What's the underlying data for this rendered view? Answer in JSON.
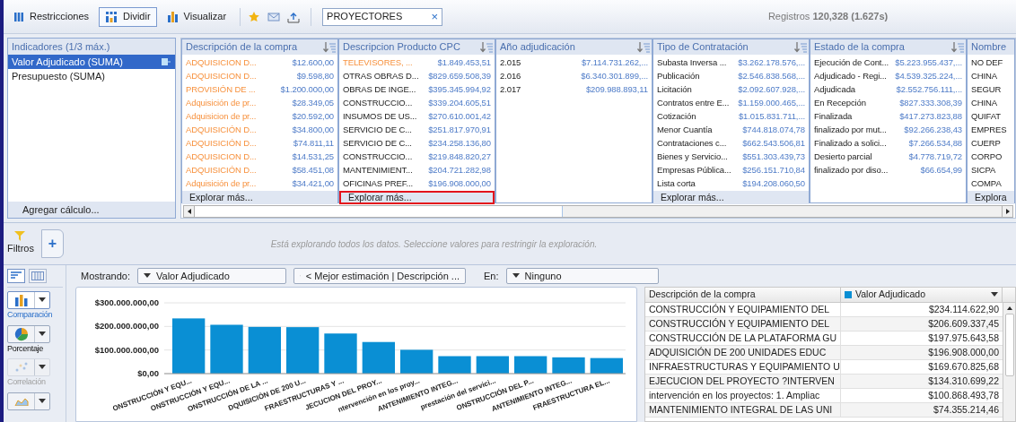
{
  "toolbar": {
    "buttons": [
      {
        "kind": "restrict",
        "label": "Restricciones",
        "selected": false
      },
      {
        "kind": "split",
        "label": "Dividir",
        "selected": true
      },
      {
        "kind": "visualize",
        "label": "Visualizar",
        "selected": false
      }
    ],
    "search": {
      "value": "PROYECTORES",
      "clear": "×"
    },
    "status": "Registros **120,328 (1.627s)**"
  },
  "indicators": {
    "title": "Indicadores (1/3 máx.)",
    "items": [
      {
        "label": "Valor Adjudicado (SUMA)",
        "selected": true
      },
      {
        "label": "Presupuesto (SUMA)",
        "selected": false
      }
    ],
    "footer": "Agregar cálculo..."
  },
  "columns": [
    {
      "header": "Descripción de la compra",
      "rows": [
        {
          "label": "ADQUISICION D...",
          "value": "$12.600,00",
          "highlighted": true
        },
        {
          "label": "ADQUISICION D...",
          "value": "$9.598,80",
          "highlighted": true
        },
        {
          "label": "PROVISIÓN DE ...",
          "value": "$1.200.000,00",
          "highlighted": true
        },
        {
          "label": "Adquisición de pr...",
          "value": "$28.349,05",
          "highlighted": true
        },
        {
          "label": "Adquisicion de pr...",
          "value": "$20.592,00",
          "highlighted": true
        },
        {
          "label": "ADQUISICIÓN D...",
          "value": "$34.800,00",
          "highlighted": true
        },
        {
          "label": "ADQUISICIÓN D...",
          "value": "$74.811,11",
          "highlighted": true
        },
        {
          "label": "ADQUISICION D...",
          "value": "$14.531,25",
          "highlighted": true
        },
        {
          "label": "ADQUISICIÓN D...",
          "value": "$58.451,08",
          "highlighted": true
        },
        {
          "label": "Adquisición de pr...",
          "value": "$34.421,00",
          "highlighted": true
        }
      ],
      "explore": {
        "label": "Explorar más...",
        "outlined": false
      }
    },
    {
      "header": "Descripcion Producto CPC",
      "rows": [
        {
          "label": "TELEVISORES, ...",
          "value": "$1.849.453,51",
          "highlighted": true
        },
        {
          "label": "OTRAS OBRAS D...",
          "value": "$829.659.508,39",
          "highlighted": false
        },
        {
          "label": "OBRAS DE INGE...",
          "value": "$395.345.994,92",
          "highlighted": false
        },
        {
          "label": "CONSTRUCCIO...",
          "value": "$339.204.605,51",
          "highlighted": false
        },
        {
          "label": "INSUMOS DE US...",
          "value": "$270.610.001,42",
          "highlighted": false
        },
        {
          "label": "SERVICIO DE C...",
          "value": "$251.817.970,91",
          "highlighted": false
        },
        {
          "label": "SERVICIO DE C...",
          "value": "$234.258.136,80",
          "highlighted": false
        },
        {
          "label": "CONSTRUCCIO...",
          "value": "$219.848.820,27",
          "highlighted": false
        },
        {
          "label": "MANTENIMIENT...",
          "value": "$204.721.282,98",
          "highlighted": false
        },
        {
          "label": "OFICINAS PREF...",
          "value": "$196.908.000,00",
          "highlighted": false
        }
      ],
      "explore": {
        "label": "Explorar más...",
        "outlined": true
      }
    },
    {
      "header": "Año adjudicación",
      "rows": [
        {
          "label": "2.015",
          "value": "$7.114.731.262,...",
          "highlighted": false
        },
        {
          "label": "2.016",
          "value": "$6.340.301.899,...",
          "highlighted": false
        },
        {
          "label": "2.017",
          "value": "$209.988.893,11",
          "highlighted": false
        }
      ]
    },
    {
      "header": "Tipo de Contratación",
      "rows": [
        {
          "label": "Subasta Inversa ...",
          "value": "$3.262.178.576,...",
          "highlighted": false
        },
        {
          "label": "Publicación",
          "value": "$2.546.838.568,...",
          "highlighted": false
        },
        {
          "label": "Licitación",
          "value": "$2.092.607.928,...",
          "highlighted": false
        },
        {
          "label": "Contratos entre E...",
          "value": "$1.159.000.465,...",
          "highlighted": false
        },
        {
          "label": "Cotización",
          "value": "$1.015.831.711,...",
          "highlighted": false
        },
        {
          "label": "Menor Cuantía",
          "value": "$744.818.074,78",
          "highlighted": false
        },
        {
          "label": "Contrataciones c...",
          "value": "$662.543.506,81",
          "highlighted": false
        },
        {
          "label": "Bienes y Servicio...",
          "value": "$551.303.439,73",
          "highlighted": false
        },
        {
          "label": "Empresas Pública...",
          "value": "$256.151.710,84",
          "highlighted": false
        },
        {
          "label": "Lista corta",
          "value": "$194.208.060,50",
          "highlighted": false
        }
      ],
      "explore": {
        "label": "Explorar más...",
        "outlined": false
      }
    },
    {
      "header": "Estado de la compra",
      "rows": [
        {
          "label": "Ejecución de Cont...",
          "value": "$5.223.955.437,...",
          "highlighted": false
        },
        {
          "label": "Adjudicado - Regi...",
          "value": "$4.539.325.224,...",
          "highlighted": false
        },
        {
          "label": "Adjudicada",
          "value": "$2.552.756.111,...",
          "highlighted": false
        },
        {
          "label": "En Recepción",
          "value": "$827.333.308,39",
          "highlighted": false
        },
        {
          "label": "Finalizada",
          "value": "$417.273.823,88",
          "highlighted": false
        },
        {
          "label": "finalizado por mut...",
          "value": "$92.266.238,43",
          "highlighted": false
        },
        {
          "label": "Finalizado a solici...",
          "value": "$7.266.534,88",
          "highlighted": false
        },
        {
          "label": "Desierto parcial",
          "value": "$4.778.719,72",
          "highlighted": false
        },
        {
          "label": "finalizado por diso...",
          "value": "$66.654,99",
          "highlighted": false
        }
      ]
    },
    {
      "header": "Nombre",
      "rows": [
        {
          "label": "NO DEF",
          "highlighted": false
        },
        {
          "label": "CHINA",
          "highlighted": false
        },
        {
          "label": "SEGUR",
          "highlighted": false
        },
        {
          "label": "CHINA",
          "highlighted": false
        },
        {
          "label": "QUIFAT",
          "highlighted": false
        },
        {
          "label": "EMPRES",
          "highlighted": false
        },
        {
          "label": "CUERP",
          "highlighted": false
        },
        {
          "label": "CORPO",
          "highlighted": false
        },
        {
          "label": "SICPA",
          "highlighted": false
        },
        {
          "label": "COMPA",
          "highlighted": false
        }
      ],
      "explore": {
        "label": "Explora",
        "outlined": false
      }
    }
  ],
  "filters": {
    "label": "Filtros",
    "add": "+",
    "message": "Está explorando todos los datos. Seleccione valores para restringir la exploración."
  },
  "view_toggle": [
    {
      "kind": "list",
      "selected": true
    },
    {
      "kind": "grid",
      "selected": false
    }
  ],
  "chart_types": [
    {
      "kind": "bar",
      "label": "Comparación",
      "selected": true,
      "disabled": false
    },
    {
      "kind": "pie",
      "label": "Porcentaje",
      "selected": false,
      "disabled": false
    },
    {
      "kind": "scatter",
      "label": "Correlación",
      "selected": false,
      "disabled": true
    },
    {
      "kind": "area",
      "selected": false,
      "disabled": false
    }
  ],
  "showing": {
    "label": "Mostrando:",
    "measure": "Valor Adjudicado",
    "dimension": "< Mejor estimación | Descripción ...",
    "in_label": "En:",
    "in_value": "Ninguno"
  },
  "chart": {
    "chart_data": {
      "type": "bar",
      "categories": [
        "ONSTRUCCIÓN Y EQU...",
        "ONSTRUCCIÓN Y EQU...",
        "ONSTRUCCIÓN DE LA ...",
        "DQUISICIÓN DE 200 U...",
        "FRAESTRUCTURAS Y ...",
        "JECUCION DEL PROY...",
        "ntervención en los proy...",
        "ANTENIMIENTO INTEG...",
        "prestación del servici...",
        "ONSTRUCCIÓN DEL P...",
        "ANTENIMIENTO INTEG...",
        "FRAESTRUCTURA  EL..."
      ],
      "series": [
        {
          "color": "#0a8fd4",
          "values": [
            234000000,
            207000000,
            198000000,
            197000000,
            170000000,
            134000000,
            101000000,
            74000000,
            74000000,
            74000000,
            69000000,
            66000000
          ]
        }
      ],
      "ylim": [
        0,
        300000000
      ],
      "yticks": [
        {
          "value": 0,
          "label": "$0,00"
        },
        {
          "value": 100000000,
          "label": "$100.000.000,00"
        },
        {
          "value": 200000000,
          "label": "$200.000.000,00"
        },
        {
          "value": 300000000,
          "label": "$300.000.000,00"
        }
      ]
    }
  },
  "table": {
    "columns": [
      {
        "label": "Descripción de la compra",
        "menu": false
      },
      {
        "label": "Valor Adjudicado",
        "menu": true
      }
    ],
    "rows": [
      {
        "cells": [
          "CONSTRUCCIÓN Y EQUIPAMIENTO DEL",
          "$234.114.622,90"
        ]
      },
      {
        "cells": [
          "CONSTRUCCIÓN Y EQUIPAMIENTO DEL",
          "$206.609.337,45"
        ]
      },
      {
        "cells": [
          "CONSTRUCCIÓN DE LA PLATAFORMA GU",
          "$197.975.643,58"
        ]
      },
      {
        "cells": [
          "ADQUISICIÓN DE 200 UNIDADES EDUC",
          "$196.908.000,00"
        ]
      },
      {
        "cells": [
          "INFRAESTRUCTURAS Y EQUIPAMIENTO U",
          "$169.670.825,68"
        ]
      },
      {
        "cells": [
          "EJECUCION DEL PROYECTO  ?INTERVEN",
          "$134.310.699,22"
        ]
      },
      {
        "cells": [
          "intervención en los proyectos: 1. Ampliac",
          "$100.868.493,78"
        ]
      },
      {
        "cells": [
          "MANTENIMIENTO INTEGRAL DE LAS UNI",
          "$74.355.214,46"
        ]
      }
    ]
  }
}
